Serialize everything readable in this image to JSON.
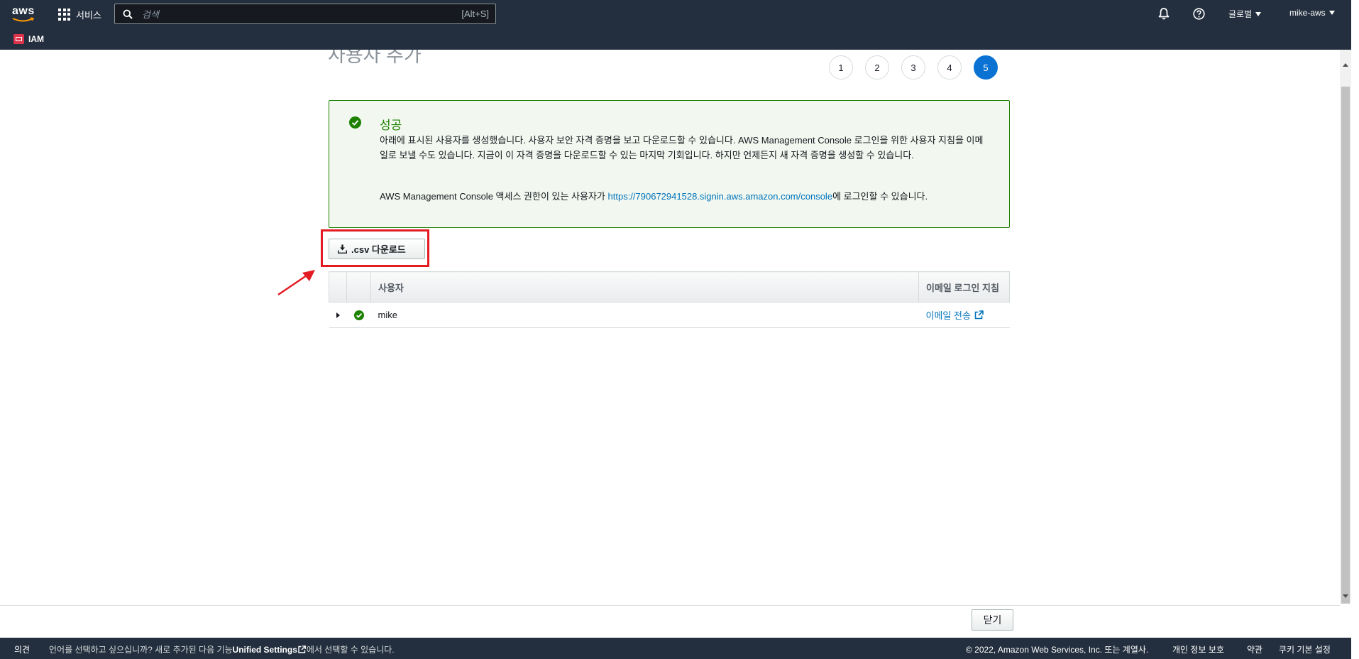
{
  "nav": {
    "logo_text": "aws",
    "services_label": "서비스",
    "search_placeholder": "검색",
    "search_shortcut": "[Alt+S]",
    "region_label": "글로벌",
    "account_label": "mike-aws",
    "favorite_service": "IAM",
    "icons": [
      "grid-icon",
      "search-icon",
      "bell-icon",
      "help-icon",
      "iam-icon"
    ]
  },
  "page": {
    "title": "사용자 추가",
    "steps": [
      "1",
      "2",
      "3",
      "4",
      "5"
    ],
    "active_step": "5"
  },
  "alert": {
    "title": "성공",
    "body": "아래에 표시된 사용자를 생성했습니다. 사용자 보안 자격 증명을 보고 다운로드할 수 있습니다. AWS Management Console 로그인을 위한 사용자 지침을 이메일로 보낼 수도 있습니다. 지금이 이 자격 증명을 다운로드할 수 있는 마지막 기회입니다. 하지만 언제든지 새 자격 증명을 생성할 수 있습니다.",
    "console_prefix": "AWS Management Console 액세스 권한이 있는 사용자가 ",
    "console_url": "https://790672941528.signin.aws.amazon.com/console",
    "console_suffix": "에 로그인할 수 있습니다."
  },
  "download_button": ".csv 다운로드",
  "table": {
    "columns": [
      "",
      "",
      "사용자",
      "이메일 로그인 지침"
    ],
    "rows": [
      {
        "user": "mike",
        "email_action": "이메일 전송"
      }
    ]
  },
  "footer": {
    "close_label": "닫기"
  },
  "bottombar": {
    "feedback": "의견",
    "lang_prefix": "언어를 선택하고 싶으십니까? 새로 추가된 다음 기능",
    "lang_link": "Unified Settings",
    "lang_suffix": "에서 선택할 수 있습니다.",
    "copyright": "© 2022, Amazon Web Services, Inc. 또는 계열사.",
    "privacy": "개인 정보 보호",
    "terms": "약관",
    "cookie": "쿠키 기본 설정"
  },
  "colors": {
    "nav_bg": "#232f3e",
    "success_green": "#1d8102",
    "link_blue": "#0073bb",
    "active_step_blue": "#0972d3",
    "highlight_red": "#e31b23"
  }
}
